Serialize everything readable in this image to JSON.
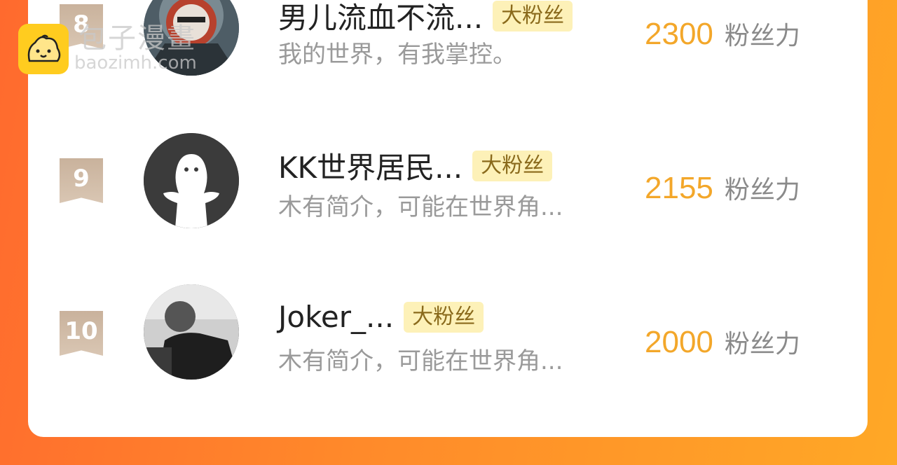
{
  "watermark": {
    "title": "包子漫畫",
    "subtitle": "baozimh.com"
  },
  "rows": [
    {
      "rank": "8",
      "name": "男儿流血不流...",
      "badge": "大粉丝",
      "bio": "我的世界，有我掌控。",
      "score": "2300",
      "score_unit": "粉丝力"
    },
    {
      "rank": "9",
      "name": "KK世界居民...",
      "badge": "大粉丝",
      "bio": "木有简介，可能在世界角...",
      "score": "2155",
      "score_unit": "粉丝力"
    },
    {
      "rank": "10",
      "name": "Joker_...",
      "badge": "大粉丝",
      "bio": "木有简介，可能在世界角...",
      "score": "2000",
      "score_unit": "粉丝力"
    }
  ],
  "colors": {
    "score": "#f3a72a",
    "badge_bg": "#fdf1b8",
    "rank_badge": "#c9b29c"
  }
}
